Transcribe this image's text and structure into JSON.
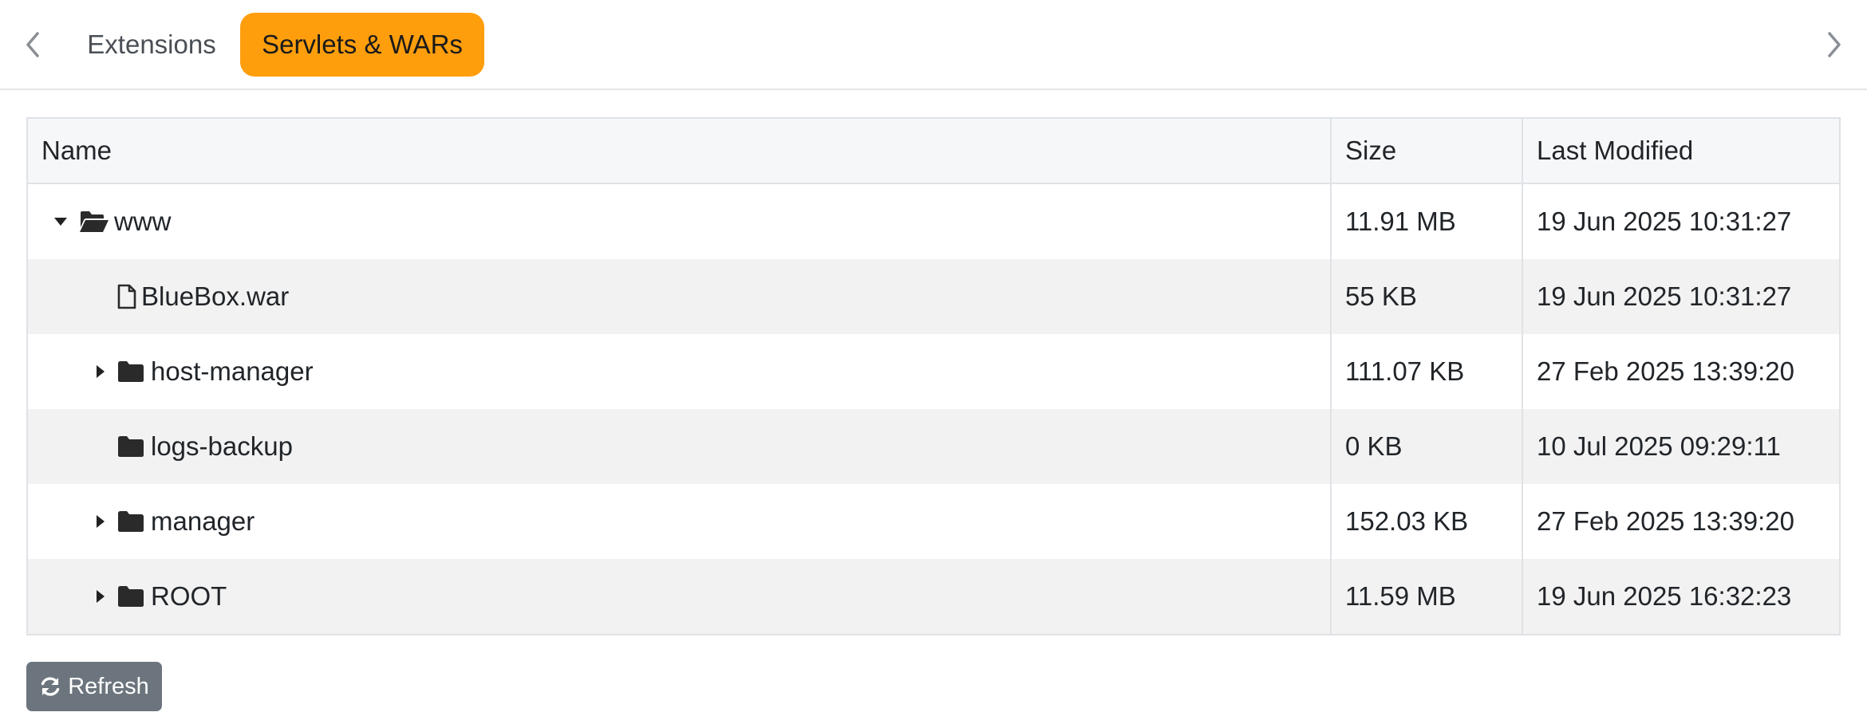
{
  "tabs": {
    "prev_icon": "chevron-left-icon",
    "next_icon": "chevron-right-icon",
    "items": [
      {
        "label": "Extensions",
        "active": false
      },
      {
        "label": "Servlets & WARs",
        "active": true
      }
    ],
    "active_color": "#ff9e0d"
  },
  "table": {
    "headers": {
      "name": "Name",
      "size": "Size",
      "modified": "Last Modified"
    },
    "rows": [
      {
        "name": "www",
        "type": "folder-open",
        "expanded": true,
        "size": "11.91 MB",
        "modified": "19 Jun 2025 10:31:27"
      },
      {
        "name": "BlueBox.war",
        "type": "file",
        "size": "55 KB",
        "modified": "19 Jun 2025 10:31:27"
      },
      {
        "name": "host-manager",
        "type": "folder",
        "expandable": true,
        "size": "111.07 KB",
        "modified": "27 Feb 2025 13:39:20"
      },
      {
        "name": "logs-backup",
        "type": "folder",
        "expandable": false,
        "size": "0 KB",
        "modified": "10 Jul 2025 09:29:11"
      },
      {
        "name": "manager",
        "type": "folder",
        "expandable": true,
        "size": "152.03 KB",
        "modified": "27 Feb 2025 13:39:20"
      },
      {
        "name": "ROOT",
        "type": "folder",
        "expandable": true,
        "size": "11.59 MB",
        "modified": "19 Jun 2025 16:32:23"
      }
    ]
  },
  "refresh_button": {
    "label": "Refresh",
    "icon": "refresh-icon",
    "color": "#6c757d"
  }
}
